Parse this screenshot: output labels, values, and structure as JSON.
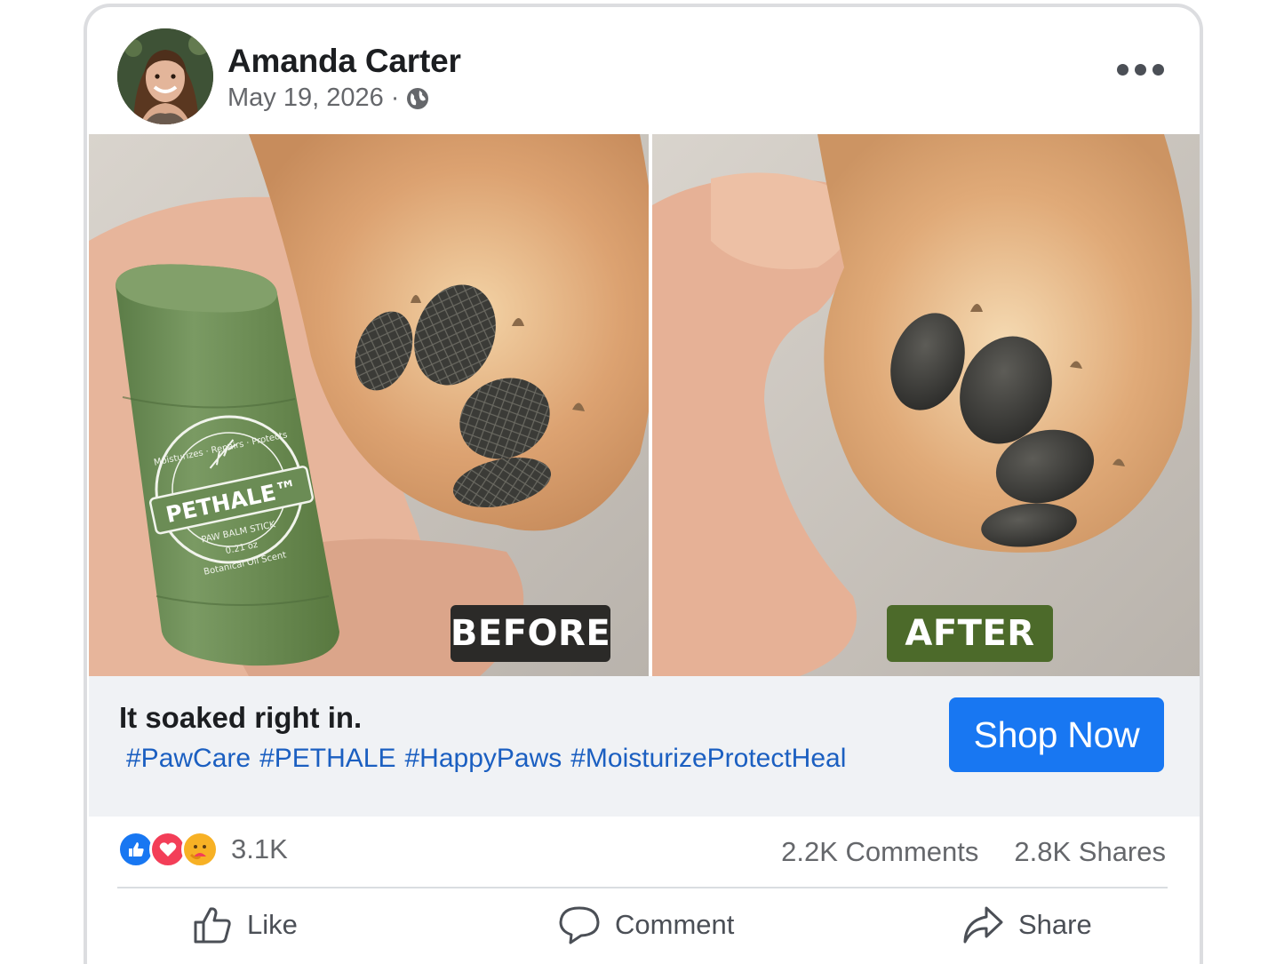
{
  "post": {
    "author_name": "Amanda Carter",
    "date": "May 19, 2026",
    "date_separator": "·",
    "privacy_icon": "globe-icon",
    "more_icon": "more-options-icon"
  },
  "image": {
    "before_label": "BEFORE",
    "after_label": "AFTER",
    "product": {
      "brand": "PETHALE™",
      "product_name": "PAW BALM STICK",
      "size": "0.21 oz",
      "ring_text_top": "Moisturizes · Repairs · Protects",
      "ring_text_bottom": "Botanical Oil Scent",
      "color": "#6b8c55"
    }
  },
  "caption": {
    "title": "It soaked right in.",
    "hashtags": [
      "#PawCare",
      "#PETHALE",
      "#HappyPaws",
      "#MoisturizeProtectHeal"
    ]
  },
  "cta": {
    "label": "Shop Now",
    "color": "#1877f2"
  },
  "stats": {
    "reaction_icons": [
      "like-icon",
      "love-icon",
      "care-icon"
    ],
    "reaction_count": "3.1K",
    "comments": "2.2K Comments",
    "shares": "2.8K Shares"
  },
  "actions": {
    "like": "Like",
    "comment": "Comment",
    "share": "Share"
  }
}
